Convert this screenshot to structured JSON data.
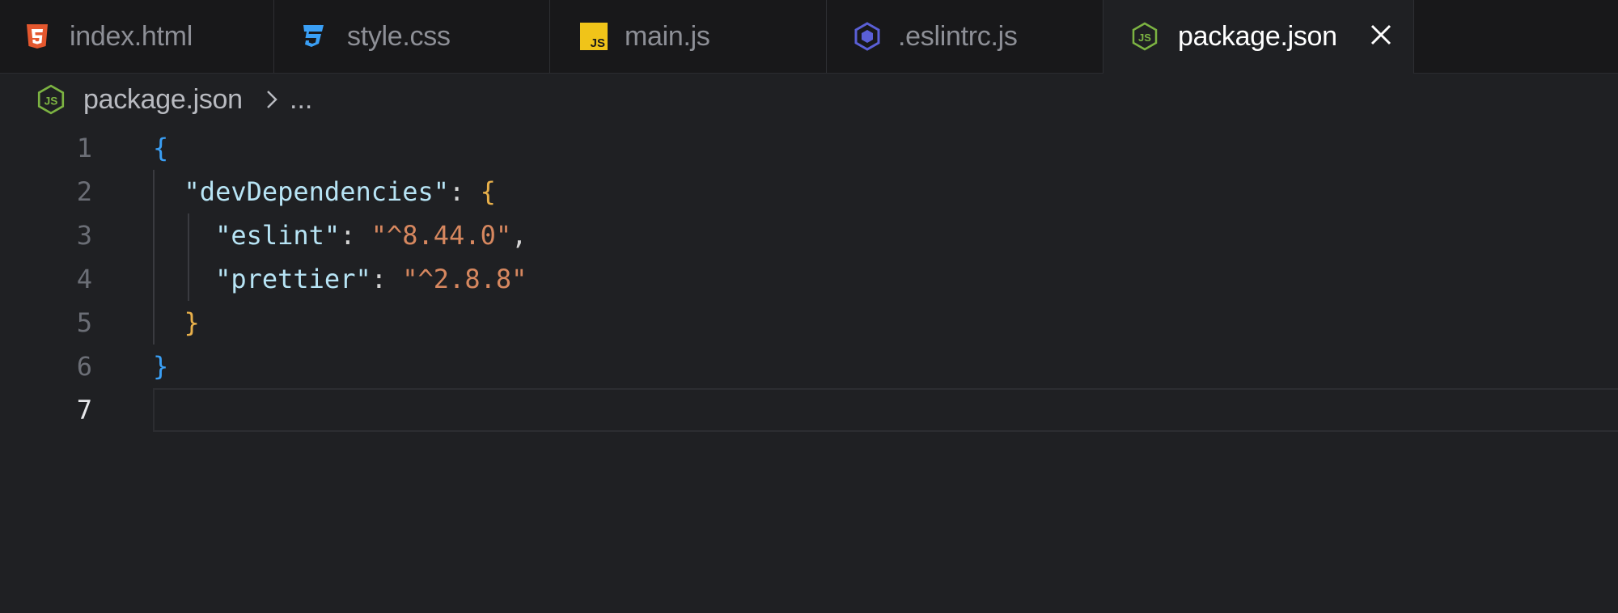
{
  "tabs": [
    {
      "label": "index.html",
      "icon": "html5-icon",
      "active": false
    },
    {
      "label": "style.css",
      "icon": "css3-icon",
      "active": false
    },
    {
      "label": "main.js",
      "icon": "javascript-icon",
      "active": false
    },
    {
      "label": ".eslintrc.js",
      "icon": "eslint-icon",
      "active": false
    },
    {
      "label": "package.json",
      "icon": "nodejs-icon",
      "active": true
    }
  ],
  "breadcrumb": {
    "file": "package.json",
    "ellipsis": "..."
  },
  "editor": {
    "current_line": 7,
    "lines": [
      {
        "number": "1"
      },
      {
        "number": "2",
        "key": "\"devDependencies\""
      },
      {
        "number": "3",
        "key": "\"eslint\"",
        "value": "\"^8.44.0\""
      },
      {
        "number": "4",
        "key": "\"prettier\"",
        "value": "\"^2.8.8\""
      },
      {
        "number": "5"
      },
      {
        "number": "6"
      },
      {
        "number": "7"
      }
    ]
  },
  "colors": {
    "background": "#1f2023",
    "tabbar": "#18181a",
    "key": "#b7e4f5",
    "string": "#d6875f",
    "brace_outer": "#3a9ff5",
    "brace_inner": "#e8b04a"
  }
}
